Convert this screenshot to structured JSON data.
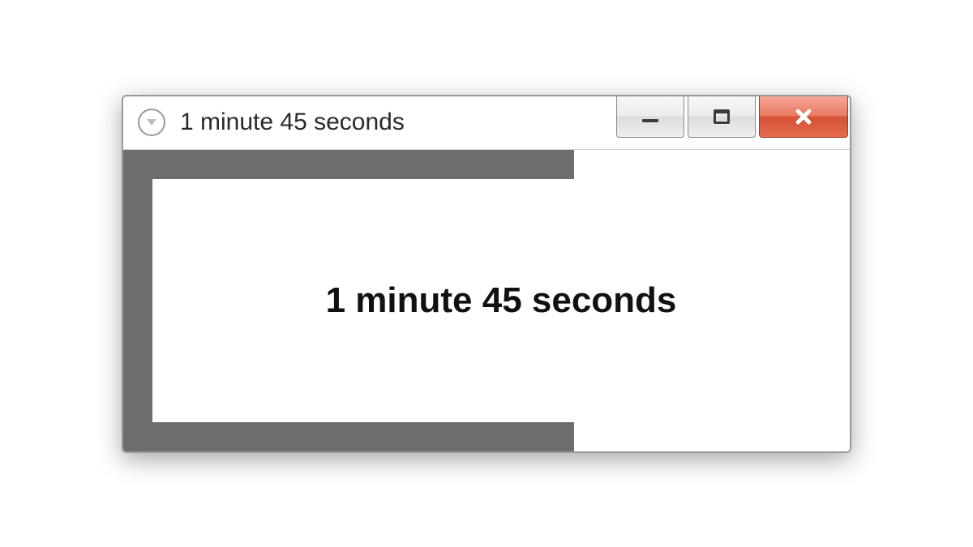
{
  "window": {
    "title": "1 minute 45 seconds",
    "icon": "clock-icon"
  },
  "controls": {
    "minimize": "minimize",
    "maximize": "maximize",
    "close": "close"
  },
  "timer": {
    "display": "1 minute 45 seconds",
    "progress_percent": 62,
    "progress_color": "#6d6d6d"
  }
}
